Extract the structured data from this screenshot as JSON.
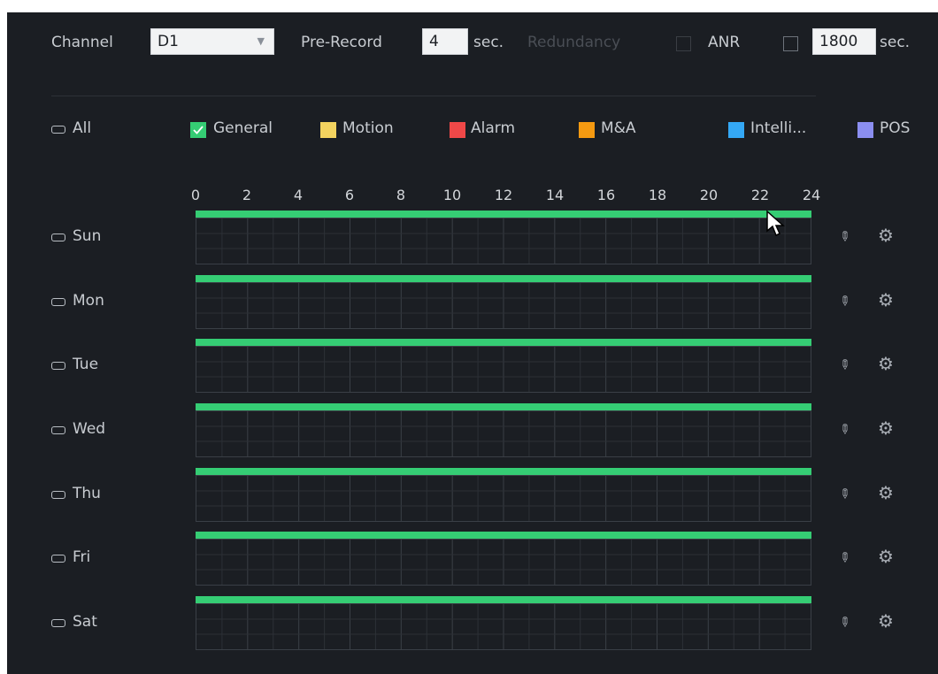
{
  "header": {
    "channel_label": "Channel",
    "channel_value": "D1",
    "prerecord_label": "Pre-Record",
    "prerecord_value": "4",
    "prerecord_unit": "sec.",
    "redundancy_label": "Redundancy",
    "anr_label": "ANR",
    "anr_value": "1800",
    "anr_unit": "sec."
  },
  "legend": {
    "all_label": "All",
    "items": [
      {
        "label": "General",
        "color": "#35cd74",
        "checked": true
      },
      {
        "label": "Motion",
        "color": "#f3d35f"
      },
      {
        "label": "Alarm",
        "color": "#f04848"
      },
      {
        "label": "M&A",
        "color": "#f59a11"
      },
      {
        "label": "Intelli...",
        "color": "#34a8f5"
      },
      {
        "label": "POS",
        "color": "#8b8ef0"
      }
    ]
  },
  "timeline": {
    "ticks": [
      "0",
      "2",
      "4",
      "6",
      "8",
      "10",
      "12",
      "14",
      "16",
      "18",
      "20",
      "22",
      "24"
    ]
  },
  "days": [
    {
      "label": "Sun",
      "general_from_hour": 0,
      "general_to_hour": 24
    },
    {
      "label": "Mon",
      "general_from_hour": 0,
      "general_to_hour": 24
    },
    {
      "label": "Tue",
      "general_from_hour": 0,
      "general_to_hour": 24
    },
    {
      "label": "Wed",
      "general_from_hour": 0,
      "general_to_hour": 24
    },
    {
      "label": "Thu",
      "general_from_hour": 0,
      "general_to_hour": 24
    },
    {
      "label": "Fri",
      "general_from_hour": 0,
      "general_to_hour": 24
    },
    {
      "label": "Sat",
      "general_from_hour": 0,
      "general_to_hour": 24
    }
  ],
  "icons": {
    "edit": "pencil-icon",
    "settings": "gear-icon"
  }
}
